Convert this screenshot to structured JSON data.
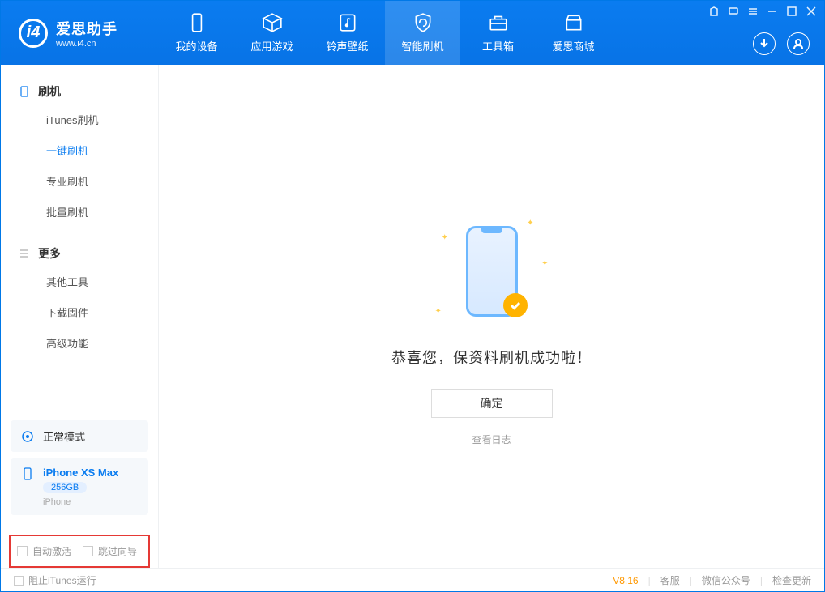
{
  "app": {
    "title": "爱思助手",
    "subtitle": "www.i4.cn"
  },
  "nav": {
    "my_device": "我的设备",
    "apps_games": "应用游戏",
    "ring_wallpaper": "铃声壁纸",
    "smart_flash": "智能刷机",
    "toolbox": "工具箱",
    "store": "爱思商城"
  },
  "sidebar": {
    "section_flash": "刷机",
    "items_flash": {
      "itunes": "iTunes刷机",
      "onekey": "一键刷机",
      "pro": "专业刷机",
      "batch": "批量刷机"
    },
    "section_more": "更多",
    "items_more": {
      "other_tools": "其他工具",
      "download_firmware": "下载固件",
      "advanced": "高级功能"
    }
  },
  "device_status": {
    "mode": "正常模式",
    "name": "iPhone XS Max",
    "capacity": "256GB",
    "type": "iPhone"
  },
  "bottom_checks": {
    "auto_activate": "自动激活",
    "skip_guide": "跳过向导"
  },
  "main": {
    "success_text": "恭喜您，保资料刷机成功啦！",
    "ok_button": "确定",
    "view_log": "查看日志"
  },
  "footer": {
    "block_itunes": "阻止iTunes运行",
    "version": "V8.16",
    "customer_service": "客服",
    "wechat": "微信公众号",
    "check_update": "检查更新"
  }
}
